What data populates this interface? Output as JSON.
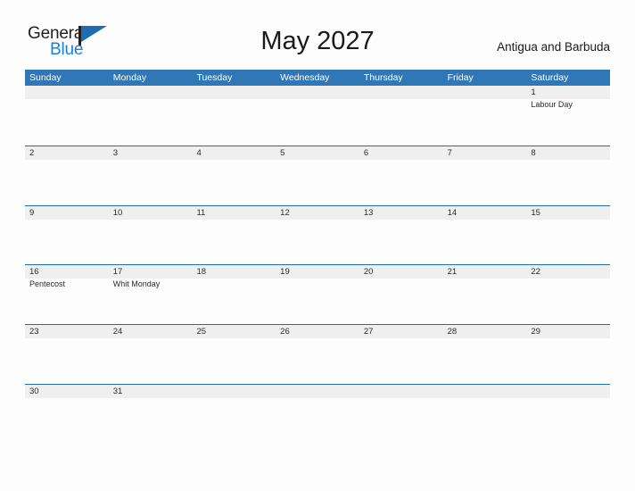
{
  "brand": {
    "name_part1": "General",
    "name_part2": "Blue",
    "flag_icon": "flag-triangle-icon"
  },
  "header": {
    "title": "May 2027",
    "country": "Antigua and Barbuda"
  },
  "colors": {
    "header_blue": "#3077b7",
    "rule_blue": "#1f6cb0",
    "band_gray": "#efefef",
    "brand_blue": "#1b7fd4",
    "text_dark": "#1a1a1a"
  },
  "calendar": {
    "weekday_headers": [
      "Sunday",
      "Monday",
      "Tuesday",
      "Wednesday",
      "Thursday",
      "Friday",
      "Saturday"
    ],
    "weeks": [
      [
        {
          "day": "",
          "event": ""
        },
        {
          "day": "",
          "event": ""
        },
        {
          "day": "",
          "event": ""
        },
        {
          "day": "",
          "event": ""
        },
        {
          "day": "",
          "event": ""
        },
        {
          "day": "",
          "event": ""
        },
        {
          "day": "1",
          "event": "Labour Day"
        }
      ],
      [
        {
          "day": "2",
          "event": ""
        },
        {
          "day": "3",
          "event": ""
        },
        {
          "day": "4",
          "event": ""
        },
        {
          "day": "5",
          "event": ""
        },
        {
          "day": "6",
          "event": ""
        },
        {
          "day": "7",
          "event": ""
        },
        {
          "day": "8",
          "event": ""
        }
      ],
      [
        {
          "day": "9",
          "event": ""
        },
        {
          "day": "10",
          "event": ""
        },
        {
          "day": "11",
          "event": ""
        },
        {
          "day": "12",
          "event": ""
        },
        {
          "day": "13",
          "event": ""
        },
        {
          "day": "14",
          "event": ""
        },
        {
          "day": "15",
          "event": ""
        }
      ],
      [
        {
          "day": "16",
          "event": "Pentecost"
        },
        {
          "day": "17",
          "event": "Whit Monday"
        },
        {
          "day": "18",
          "event": ""
        },
        {
          "day": "19",
          "event": ""
        },
        {
          "day": "20",
          "event": ""
        },
        {
          "day": "21",
          "event": ""
        },
        {
          "day": "22",
          "event": ""
        }
      ],
      [
        {
          "day": "23",
          "event": ""
        },
        {
          "day": "24",
          "event": ""
        },
        {
          "day": "25",
          "event": ""
        },
        {
          "day": "26",
          "event": ""
        },
        {
          "day": "27",
          "event": ""
        },
        {
          "day": "28",
          "event": ""
        },
        {
          "day": "29",
          "event": ""
        }
      ],
      [
        {
          "day": "30",
          "event": ""
        },
        {
          "day": "31",
          "event": ""
        },
        {
          "day": "",
          "event": ""
        },
        {
          "day": "",
          "event": ""
        },
        {
          "day": "",
          "event": ""
        },
        {
          "day": "",
          "event": ""
        },
        {
          "day": "",
          "event": ""
        }
      ]
    ]
  }
}
